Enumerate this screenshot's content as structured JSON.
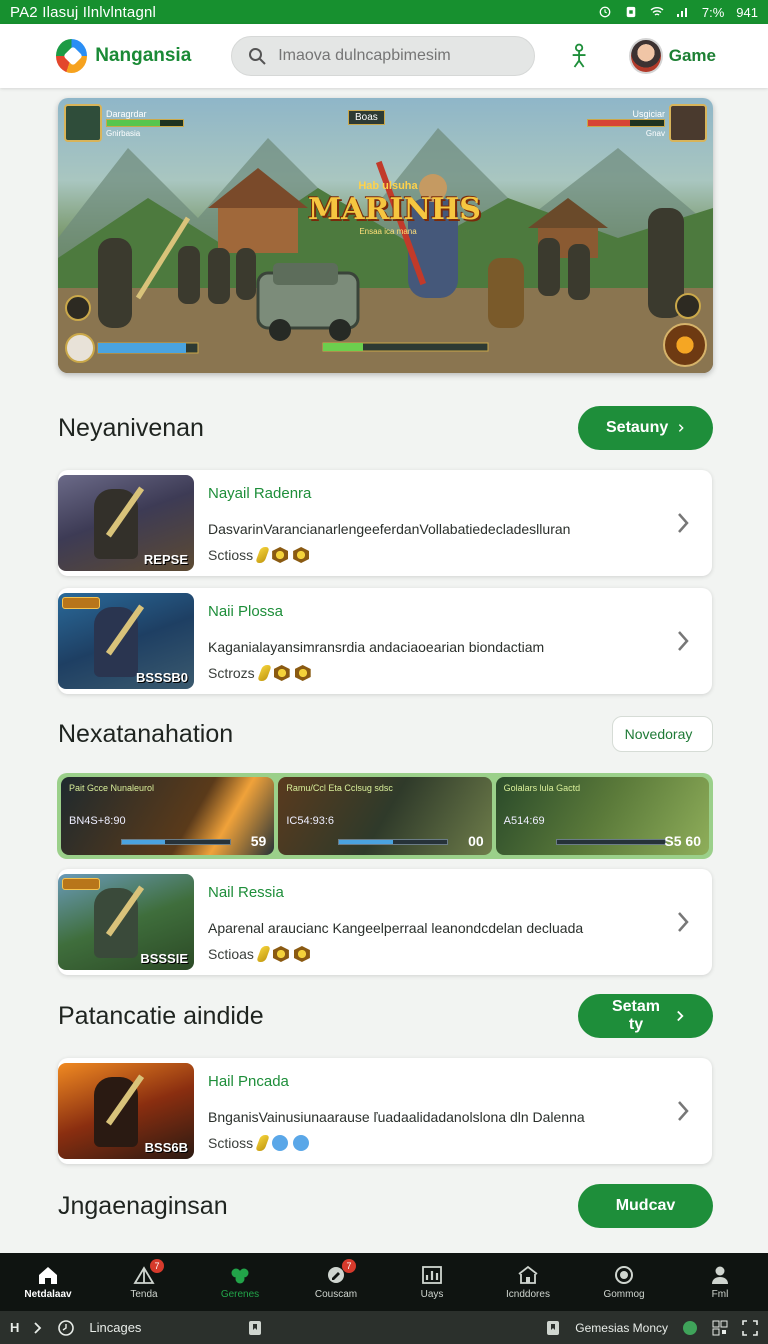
{
  "status_bar": {
    "left_text": "PA2 Ilasuj Ilnlvlntagnl",
    "battery": "7:%",
    "time": "941"
  },
  "header": {
    "brand": "Nangansia",
    "search_placeholder": "Imaova dulncapbimesim",
    "game_label": "Game"
  },
  "hero": {
    "subtitle": "Hab ulsuha",
    "title": "MARINHS",
    "tagline": "Ensaa ica mana",
    "hud_left_name": "Daragrdar",
    "hud_right_name": "Usgiciar",
    "hud_center": "Boas",
    "hud_left_sub": "Gnirbasia",
    "hud_right_sub": "Gnav"
  },
  "sections": [
    {
      "title": "Neyanivenan",
      "button": "Setauny"
    },
    {
      "title": "Nexatanahation",
      "button": "Novedoray"
    },
    {
      "title": "Patancatie aindide",
      "button": "Setam ty"
    },
    {
      "title": "Jngaenaginsan",
      "button": "Mudcav"
    }
  ],
  "cards": [
    {
      "name": "Nayail Radenra",
      "desc": "DasvarinVarancianarlengeeferdanVollabatiedecladeslluran",
      "meta": "Sctioss",
      "badge": "REPSE"
    },
    {
      "name": "Naii Plossa",
      "desc": "Kaganialayansimransrdia andaciaoearian biondactiam",
      "meta": "Sctrozs",
      "badge": "BSSSB0"
    },
    {
      "name": "Nail Ressia",
      "desc": "Aparenal araucianc Kangeelperraal leanondcdelan decluada",
      "meta": "Sctioas",
      "badge": "BSSSIE"
    },
    {
      "name": "Hail Pncada",
      "desc": "BnganisVainusiunaarause ľuadaalidadanolslona dln Dalenna",
      "meta": "Sctioss",
      "badge": "BSS6B"
    }
  ],
  "strip": [
    {
      "title": "Pait Gcce Nunaleurol",
      "num": "BN4S+8:90",
      "score": "59",
      "progress_pct": 40
    },
    {
      "title": "Ramu/Ccl Eta Cclsug sdsc",
      "num": "IC54:93:6",
      "score": "00",
      "progress_pct": 50
    },
    {
      "title": "Golalars lula Gactd",
      "num": "A514:69",
      "score": "S5 60",
      "progress_pct": 0
    }
  ],
  "bottom_nav": [
    {
      "label": "Netdalaav",
      "state": "active"
    },
    {
      "label": "Tenda",
      "badge": "7"
    },
    {
      "label": "Gerenes",
      "state": "green"
    },
    {
      "label": "Couscam",
      "badge": "7"
    },
    {
      "label": "Uays"
    },
    {
      "label": "Icnddores"
    },
    {
      "label": "Gommog"
    },
    {
      "label": "Fml"
    }
  ],
  "system_bar": {
    "label": "Lincages",
    "right_label": "Gemesias Moncy"
  },
  "colors": {
    "accent": "#1e8e3a",
    "status": "#17902f",
    "nav_bg": "#0f1411"
  }
}
